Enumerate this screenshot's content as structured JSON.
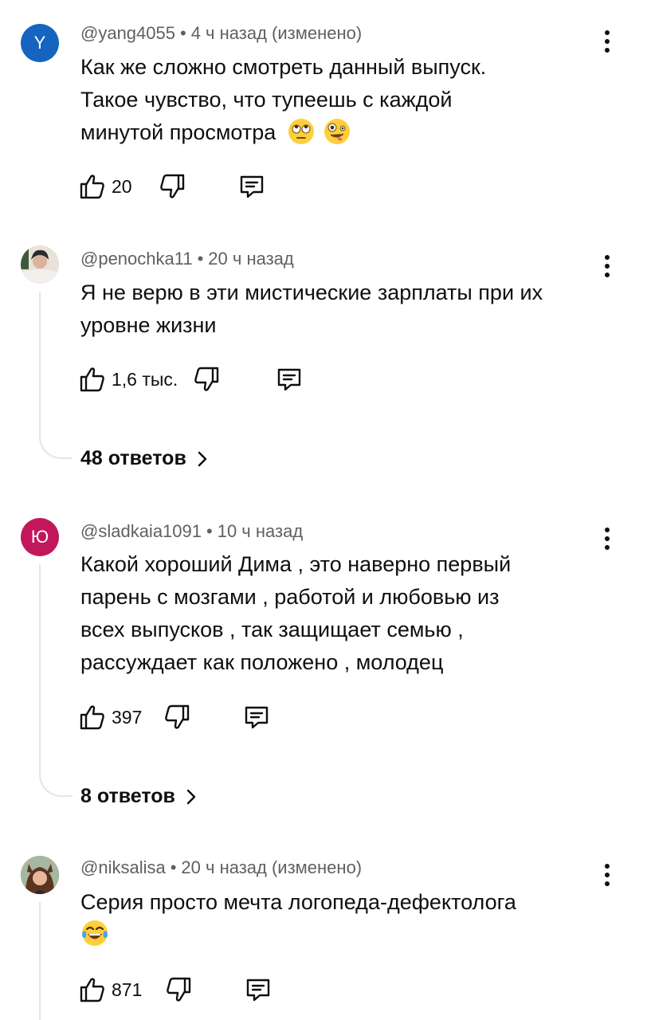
{
  "comments": [
    {
      "avatar_letter": "Y",
      "avatar_color": "#1565c0",
      "author": "@yang4055",
      "time": "4 ч назад (изменено)",
      "text_lines": [
        "Как же сложно смотреть данный выпуск.",
        "Такое чувство, что тупеешь  с каждой",
        "минутой просмотра"
      ],
      "emojis": [
        "rolling-eyes-emoji",
        "zany-face-emoji"
      ],
      "likes": "20"
    },
    {
      "avatar_letter": "",
      "avatar_color": "#c9b8a8",
      "author": "@penochka11",
      "time": "20 ч назад",
      "text_lines": [
        "Я не верю в эти мистические зарплаты при их",
        "уровне жизни"
      ],
      "likes": "1,6 тыс.",
      "replies": "48 ответов"
    },
    {
      "avatar_letter": "Ю",
      "avatar_color": "#c2185b",
      "author": "@sladkaia1091",
      "time": "10 ч назад",
      "text_lines": [
        "Какой хороший Дима , это наверно первый",
        "парень с мозгами , работой и любовью из",
        "всех выпусков , так защищает семью ,",
        "рассуждает как положено , молодец"
      ],
      "likes": "397",
      "replies": "8 ответов"
    },
    {
      "avatar_letter": "",
      "avatar_color": "#6d4c41",
      "author": "@niksalisa",
      "time": "20 ч назад (изменено)",
      "text_lines": [
        "Серия просто мечта логопеда-дефектолога"
      ],
      "emojis": [
        "tears-of-joy-emoji"
      ],
      "likes": "871"
    }
  ],
  "separator": "•"
}
